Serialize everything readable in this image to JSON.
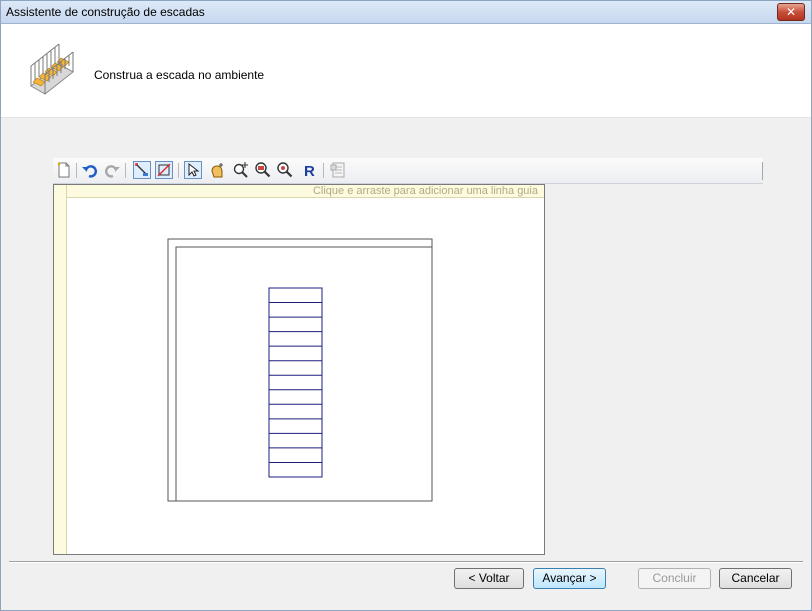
{
  "window": {
    "title": "Assistente de construção de escadas",
    "close_label": "✕"
  },
  "header": {
    "instruction": "Construa a escada no ambiente"
  },
  "toolbar": {
    "buttons": [
      "new-icon",
      "undo-icon",
      "redo-icon",
      "draw-stair-icon",
      "draw-area-icon",
      "select-pointer-icon",
      "pan-hand-icon",
      "zoom-fit-icon",
      "zoom-in-icon",
      "zoom-out-icon",
      "redraw-icon",
      "properties-icon"
    ]
  },
  "canvas": {
    "hint": "Clique e arraste para adicionar uma linha guia",
    "stair_steps": 13
  },
  "footer": {
    "back_label": "< Voltar",
    "next_label": "Avançar >",
    "finish_label": "Concluir",
    "cancel_label": "Cancelar"
  },
  "colors": {
    "stair_line": "#1e1e80",
    "wall_line": "#555555",
    "ruler": "#fdfbdf"
  }
}
